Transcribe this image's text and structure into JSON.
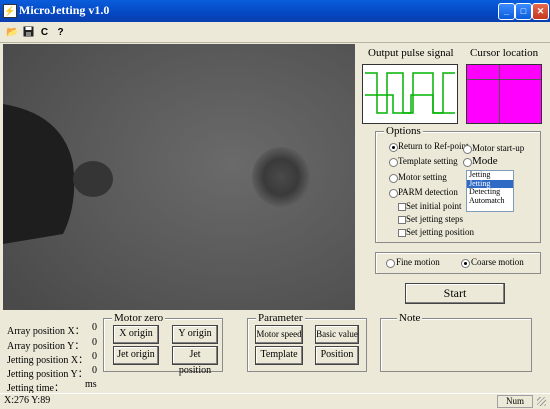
{
  "window": {
    "title": "MicroJetting v1.0",
    "app_icon": "lightning-icon"
  },
  "toolbar": {
    "items": [
      "open-folder-icon",
      "save-icon",
      "C",
      "help-icon"
    ],
    "c_label": "C"
  },
  "output_pulse": {
    "title": "Output pulse signal"
  },
  "cursor_location": {
    "title": "Cursor location",
    "fill_color": "#ff00ff"
  },
  "options": {
    "title": "Options",
    "return_ref": "Return to Ref-point",
    "motor_startup": "Motor start-up",
    "template_setting": "Template setting",
    "mode_label": "Mode",
    "motor_setting": "Motor setting",
    "parm_detection": "PARM detection",
    "set_initial_point": "Set initial point",
    "set_jetting_steps": "Set jetting steps",
    "set_jetting_position": "Set jetting position",
    "mode_list": [
      "Jetting",
      "Jetting",
      "Detecting",
      "Automatch"
    ],
    "mode_selected_index": 1
  },
  "motion": {
    "fine": "Fine motion",
    "coarse": "Coarse motion",
    "selected": "coarse"
  },
  "start_button": "Start",
  "note": {
    "title": "Note"
  },
  "positions": {
    "array_x_label": "Array position   X：",
    "array_x": "0",
    "array_y_label": "Array position   Y：",
    "array_y": "0",
    "jet_x_label": "Jetting position  X：",
    "jet_x": "0",
    "jet_y_label": "Jetting position  Y：",
    "jet_y": "0",
    "jet_time_label": "Jetting time：",
    "jet_time_unit": "ms"
  },
  "motor_zero": {
    "title": "Motor zero",
    "x_origin": "X origin",
    "y_origin": "Y origin",
    "jet_origin": "Jet origin",
    "jet_position": "Jet position"
  },
  "parameter": {
    "title": "Parameter",
    "motor_speed": "Motor speed",
    "basic_value": "Basic value",
    "template": "Template",
    "position": "Position"
  },
  "status": {
    "coords": "X:276 Y:89",
    "num": "Num"
  }
}
